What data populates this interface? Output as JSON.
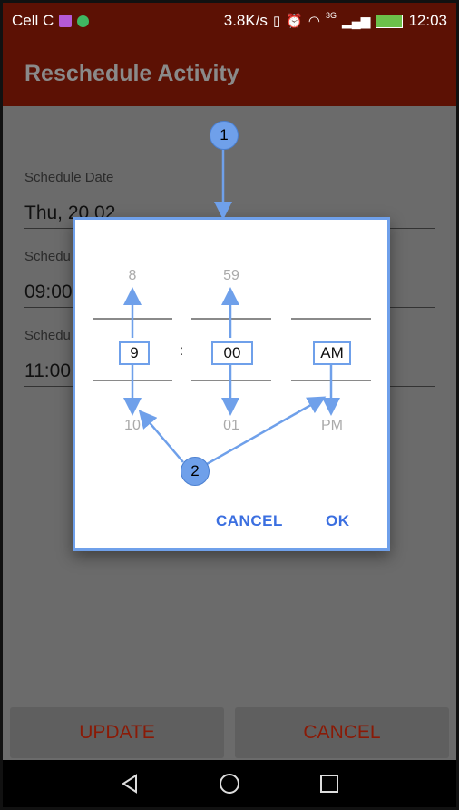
{
  "status_bar": {
    "carrier": "Cell C",
    "speed": "3.8K/s",
    "network": "3G",
    "time": "12:03"
  },
  "app_bar": {
    "title": "Reschedule Activity"
  },
  "form": {
    "date_label": "Schedule Date",
    "date_value": "Thu, 20 02",
    "start_label": "Schedu",
    "start_value": "09:00",
    "end_label": "Schedu",
    "end_value": "11:00"
  },
  "time_picker": {
    "hour": {
      "above": "8",
      "selected": "9",
      "below": "10"
    },
    "minute": {
      "above": "59",
      "selected": "00",
      "below": "01"
    },
    "meridiem": {
      "above": "",
      "selected": "AM",
      "below": "PM"
    },
    "separator": ":",
    "cancel_label": "CANCEL",
    "ok_label": "OK"
  },
  "bottom_buttons": {
    "update_label": "UPDATE",
    "cancel_label": "CANCEL"
  },
  "annotations": {
    "callout_1": "1",
    "callout_2": "2"
  },
  "colors": {
    "header": "#5c1104",
    "dialog_accent": "#3b6fe0",
    "annotation": "#6fa0ea",
    "button_text": "#8a1a06"
  }
}
